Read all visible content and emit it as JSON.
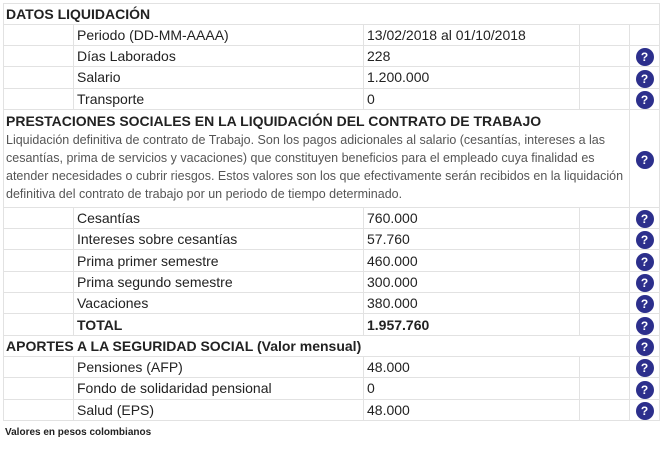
{
  "sections": {
    "datos": {
      "title": "DATOS LIQUIDACIÓN",
      "rows": [
        {
          "label": "Periodo (DD-MM-AAAA)",
          "value": "13/02/2018 al 01/10/2018",
          "help": false
        },
        {
          "label": "Días Laborados",
          "value": "228",
          "help": true
        },
        {
          "label": "Salario",
          "value": "1.200.000",
          "help": true
        },
        {
          "label": "Transporte",
          "value": "0",
          "help": true
        }
      ]
    },
    "prestaciones": {
      "title": "PRESTACIONES SOCIALES EN LA LIQUIDACIÓN DEL CONTRATO DE TRABAJO",
      "description": "Liquidación definitiva de contrato de Trabajo. Son los pagos adicionales al salario (cesantías, intereses a las cesantías, prima de servicios y vacaciones) que constituyen beneficios para el empleado cuya finalidad es atender necesidades o cubrir riesgos. Estos valores son los que efectivamente serán recibidos en la liquidación definitiva del contrato de trabajo por un periodo de tiempo determinado.",
      "rows": [
        {
          "label": "Cesantías",
          "value": "760.000"
        },
        {
          "label": "Intereses sobre cesantías",
          "value": "57.760"
        },
        {
          "label": "Prima primer semestre",
          "value": "460.000"
        },
        {
          "label": "Prima segundo semestre",
          "value": "300.000"
        },
        {
          "label": "Vacaciones",
          "value": "380.000"
        }
      ],
      "total_label": "TOTAL",
      "total_value": "1.957.760"
    },
    "aportes": {
      "title": "APORTES A LA SEGURIDAD SOCIAL (Valor mensual)",
      "rows": [
        {
          "label": "Pensiones (AFP)",
          "value": "48.000"
        },
        {
          "label": "Fondo de solidaridad pensional",
          "value": "0"
        },
        {
          "label": "Salud (EPS)",
          "value": "48.000"
        }
      ]
    }
  },
  "help_symbol": "?",
  "footnote": "Valores en pesos colombianos",
  "colors": {
    "help_button": "#2c2f8c",
    "border": "#e2e2e2"
  }
}
